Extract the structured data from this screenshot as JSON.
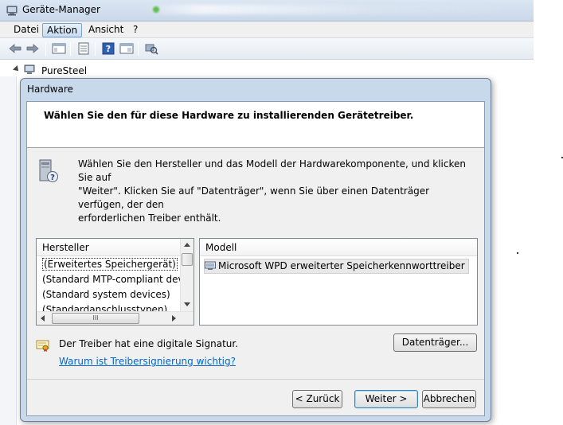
{
  "window": {
    "title": "Geräte-Manager"
  },
  "menubar": {
    "items": [
      "Datei",
      "Aktion",
      "Ansicht",
      "?"
    ],
    "active_index": 1
  },
  "toolbar": {
    "icons": [
      "back-arrow-icon",
      "forward-arrow-icon",
      "console-tree-icon",
      "properties-icon",
      "help-icon",
      "details-pane-icon",
      "scan-hardware-icon"
    ]
  },
  "tree": {
    "root_label": "PureSteel",
    "expanded": true
  },
  "dialog": {
    "title": "Hardware",
    "header": "Wählen Sie den für diese Hardware zu installierenden Gerätetreiber.",
    "info_lines": [
      "Wählen Sie den Hersteller und das Modell der Hardwarekomponente, und klicken Sie auf",
      "\"Weiter\". Klicken Sie auf \"Datenträger\", wenn Sie über einen Datenträger verfügen, der den",
      "erforderlichen Treiber enthält."
    ],
    "manufacturer_list": {
      "header": "Hersteller",
      "items": [
        "(Erweitertes Speichergerät)",
        "(Standard MTP-compliant device",
        "(Standard system devices)",
        "(Standardanschlusstypen)"
      ],
      "selected_index": 0,
      "hscroll_thumb_glyph": "III"
    },
    "model_list": {
      "header": "Modell",
      "items": [
        "Microsoft WPD erweiterter Speicherkennworttreiber"
      ],
      "selected_index": 0
    },
    "signature_text": "Der Treiber hat eine digitale Signatur.",
    "signature_link": "Warum ist Treibersignierung wichtig?",
    "buttons": {
      "disk": "Datenträger...",
      "back": "< Zurück",
      "next": "Weiter >",
      "cancel": "Abbrechen"
    }
  }
}
